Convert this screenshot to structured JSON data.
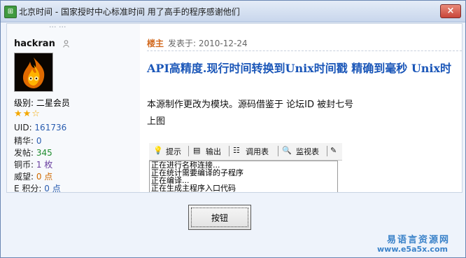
{
  "window": {
    "title": "北京时间 - 国家授时中心标准时间    用了高手的程序感谢他们",
    "app_icon": "app-icon",
    "close_label": "×"
  },
  "sidebar": {
    "cut_text": "... ...",
    "username": "hackran",
    "rank": "级别: 二星会员",
    "stars": "★★☆",
    "stats": [
      {
        "label": "UID: ",
        "value": "161736"
      },
      {
        "label": "精华: ",
        "value": "0"
      },
      {
        "label": "发帖: ",
        "value": "345"
      },
      {
        "label": "铜币: ",
        "value": "1 枚"
      },
      {
        "label": "威望: ",
        "value": "0 点"
      },
      {
        "label": "E 积分: ",
        "value": "0 点"
      }
    ]
  },
  "post": {
    "author_tag": "楼主",
    "date": "发表于: 2010-12-24",
    "title": "API高精度.现行时间转换到Unix时间戳 精确到毫秒 Unix时",
    "body_lines": [
      "本源制作更改为模块。源码借鉴于 论坛ID 被封七号",
      "上图"
    ]
  },
  "ide": {
    "toolbar": {
      "hint": "提示",
      "output": "输出",
      "call_stack": "调用表",
      "watch": "监视表"
    },
    "log": [
      "正在进行名称连接...",
      "正在统计需要编译的子程序",
      "正在编译...",
      "正在生成主程序入口代码"
    ]
  },
  "button": {
    "label": "按钮"
  },
  "watermark": {
    "title": "易语言资源网",
    "url": "www.e5a5x.com"
  }
}
